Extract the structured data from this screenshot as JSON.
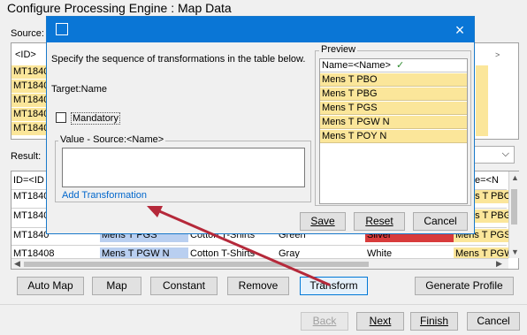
{
  "background": {
    "title": "Configure Processing Engine : Map Data",
    "source_label": "Source:",
    "source_header": "<ID>",
    "source_rows": [
      "MT1840",
      "MT1840",
      "MT1840",
      "MT1840",
      "MT1840"
    ],
    "result_label": "Result:",
    "result_header_left": "ID=<ID",
    "result_header_right": "e=<N",
    "result_rows": [
      {
        "id": "MT1840",
        "name": "",
        "c3": "",
        "c4": "",
        "c5": "",
        "c6": "ns T PBO"
      },
      {
        "id": "MT1840",
        "name": "",
        "c3": "",
        "c4": "",
        "c5": "",
        "c6": "ns T PBG"
      },
      {
        "id": "MT1840",
        "name": "Mens T PGS",
        "c3": "Cotton T-Shirts",
        "c4": "Green",
        "c5": "Silver",
        "c6": "Mens T PGS"
      },
      {
        "id": "MT18408",
        "name": "Mens T PGW N",
        "c3": "Cotton T-Shirts",
        "c4": "Gray",
        "c5": "White",
        "c6": "Mens T PGW"
      }
    ],
    "buttons": {
      "auto_map": "Auto Map",
      "map": "Map",
      "constant": "Constant",
      "remove": "Remove",
      "transform": "Transform",
      "generate_profile": "Generate Profile",
      "back": "Back",
      "next": "Next",
      "finish": "Finish",
      "cancel": "Cancel"
    }
  },
  "dialog": {
    "instruction": "Specify the sequence of transformations in the table below.",
    "target": "Target:Name",
    "mandatory_label": "Mandatory",
    "mandatory_checked": false,
    "value_group_label": "Value - Source:<Name>",
    "value_text": "",
    "add_transformation": "Add Transformation",
    "preview_label": "Preview",
    "preview_header": "Name=<Name>",
    "preview_check": "✓",
    "preview_rows": [
      "Mens T PBO",
      "Mens T PBG",
      "Mens T PGS",
      "Mens T PGW N",
      "Mens T POY N"
    ],
    "buttons": {
      "save": "Save",
      "reset": "Reset",
      "cancel": "Cancel"
    },
    "close_icon": "×"
  },
  "colors": {
    "titlebar": "#0a76d6",
    "highlight_yellow": "#fbe69a",
    "highlight_blue": "#b9cff0",
    "highlight_red": "#d83b3b",
    "annotation_arrow": "#b5293a",
    "link": "#0066cc"
  }
}
